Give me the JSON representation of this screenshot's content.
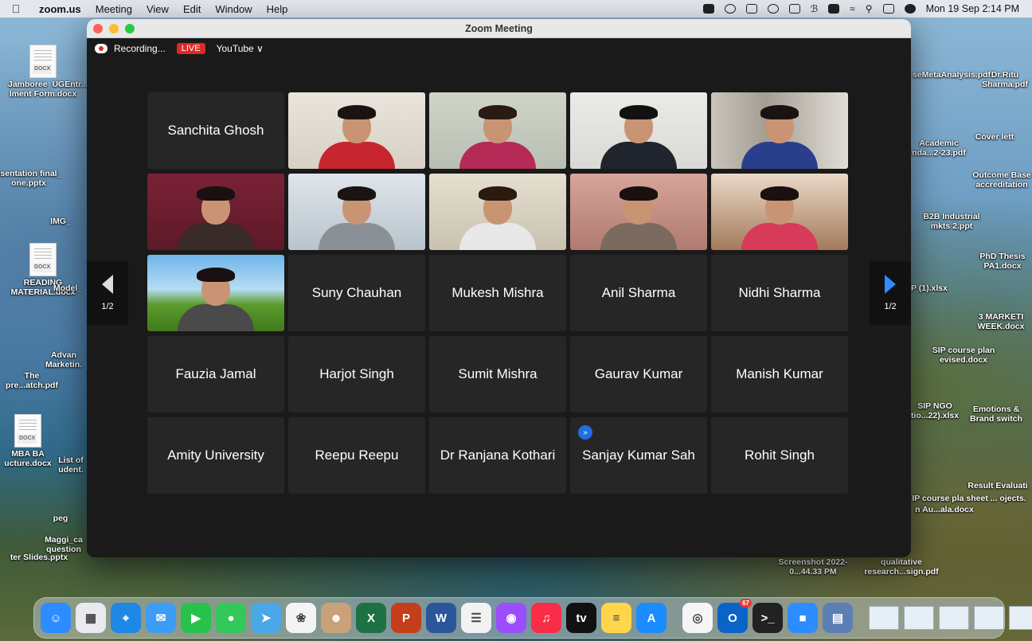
{
  "menubar": {
    "app_name": "zoom.us",
    "menus": [
      "Meeting",
      "View",
      "Edit",
      "Window",
      "Help"
    ],
    "clock": "Mon 19 Sep  2:14 PM"
  },
  "window": {
    "title": "Zoom Meeting",
    "recording_label": "Recording...",
    "live_label": "LIVE",
    "stream_label": "YouTube ∨"
  },
  "grid": {
    "tiles": [
      {
        "name": "Sanchita Ghosh",
        "video": false
      },
      {
        "name": "",
        "video": true
      },
      {
        "name": "",
        "video": true
      },
      {
        "name": "",
        "video": true,
        "active": true
      },
      {
        "name": "",
        "video": true
      },
      {
        "name": "",
        "video": true
      },
      {
        "name": "",
        "video": true
      },
      {
        "name": "",
        "video": true
      },
      {
        "name": "",
        "video": true
      },
      {
        "name": "",
        "video": true
      },
      {
        "name": "",
        "video": true
      },
      {
        "name": "Suny Chauhan",
        "video": false
      },
      {
        "name": "Mukesh Mishra",
        "video": false
      },
      {
        "name": "Anil Sharma",
        "video": false
      },
      {
        "name": "Nidhi Sharma",
        "video": false
      },
      {
        "name": "Fauzia Jamal",
        "video": false
      },
      {
        "name": "Harjot Singh",
        "video": false
      },
      {
        "name": "Sumit Mishra",
        "video": false
      },
      {
        "name": "Gaurav Kumar",
        "video": false
      },
      {
        "name": "Manish Kumar",
        "video": false
      },
      {
        "name": "Amity University",
        "video": false
      },
      {
        "name": "Reepu Reepu",
        "video": false
      },
      {
        "name": "Dr Ranjana Kothari",
        "video": false
      },
      {
        "name": "Sanjay Kumar Sah",
        "video": false,
        "badge": true
      },
      {
        "name": "Rohit Singh",
        "video": false
      }
    ],
    "page_left": "1/2",
    "page_right": "1/2"
  },
  "desktop_icons": {
    "left": [
      "Jamboree_UGEntr... lment Form.docx",
      "esentation final_ one.pptx",
      "IMG_",
      "READING MATERIAL.docx",
      "Model_",
      "Advan Marketin.",
      "The pre...atch.pdf",
      "MBA BA ucture.docx",
      "List of udent.",
      "peg",
      "Maggi_ca question",
      "ter Slides.pptx"
    ],
    "right": [
      "seMetaAnalysis.pdf",
      "Dr.Ritu Sharma.pdf",
      "Academic nda...2-23.pdf",
      "Cover lett",
      "Outcome Base accreditation",
      "B2B Industrial mkts 2.ppt",
      "PhD Thesis PA1.docx",
      "P (1).xlsx",
      "3 MARKETI WEEK.docx",
      "SIP course plan evised.docx",
      "SIP NGO tio...22).xlsx",
      "Emotions & Brand switch",
      "Result Evaluati",
      "IP course pla sheet ... ojects.",
      "n Au...ala.docx",
      "Screenshot 2022-0...44.33 PM",
      "qualitative research...sign.pdf"
    ]
  },
  "dock": {
    "apps": [
      {
        "name": "finder",
        "color": "#2d8cff",
        "glyph": "☺"
      },
      {
        "name": "launchpad",
        "color": "#e9eaf0",
        "glyph": "▦"
      },
      {
        "name": "safari",
        "color": "#1e88e5",
        "glyph": "⌖"
      },
      {
        "name": "mail",
        "color": "#3d9df5",
        "glyph": "✉"
      },
      {
        "name": "facetime",
        "color": "#27c24c",
        "glyph": "▶"
      },
      {
        "name": "messages",
        "color": "#34c759",
        "glyph": "●"
      },
      {
        "name": "maps",
        "color": "#4aa7e8",
        "glyph": "➤"
      },
      {
        "name": "photos",
        "color": "#f4f4f4",
        "glyph": "❀"
      },
      {
        "name": "contacts",
        "color": "#c9a27a",
        "glyph": "☻"
      },
      {
        "name": "excel",
        "color": "#1e7145",
        "glyph": "X"
      },
      {
        "name": "powerpoint",
        "color": "#c43e1c",
        "glyph": "P"
      },
      {
        "name": "word",
        "color": "#2b579a",
        "glyph": "W"
      },
      {
        "name": "reminders",
        "color": "#f2f2f2",
        "glyph": "☰"
      },
      {
        "name": "podcasts",
        "color": "#9b4dff",
        "glyph": "◉"
      },
      {
        "name": "music",
        "color": "#fa2d48",
        "glyph": "♫"
      },
      {
        "name": "tv",
        "color": "#111111",
        "glyph": "tv"
      },
      {
        "name": "notes",
        "color": "#ffd64a",
        "glyph": "≡"
      },
      {
        "name": "app-store",
        "color": "#1a8cff",
        "glyph": "A"
      },
      {
        "name": "chrome",
        "color": "#f5f5f5",
        "glyph": "◎"
      },
      {
        "name": "outlook",
        "color": "#0a64c8",
        "glyph": "O",
        "notif": "67"
      },
      {
        "name": "terminal",
        "color": "#222222",
        "glyph": ">_"
      },
      {
        "name": "zoom",
        "color": "#2d8cff",
        "glyph": "■"
      },
      {
        "name": "preview",
        "color": "#5b7fb5",
        "glyph": "▤"
      }
    ]
  }
}
